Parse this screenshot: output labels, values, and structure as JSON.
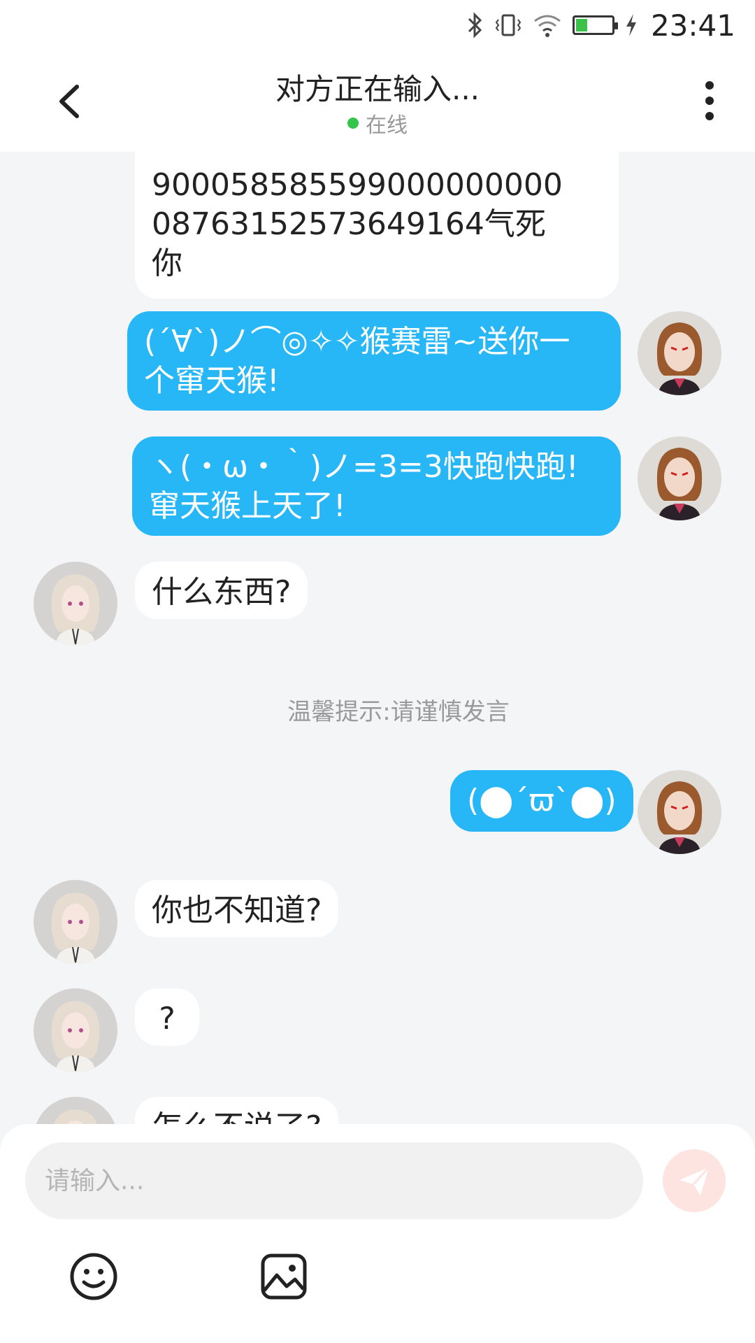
{
  "status_bar": {
    "time": "23:41",
    "icons": [
      "bluetooth-icon",
      "vibrate-icon",
      "wifi-icon",
      "battery-icon",
      "charging-icon"
    ],
    "battery_level": 0.3
  },
  "header": {
    "title": "对方正在输入...",
    "status": "在线",
    "status_color": "#34c64a"
  },
  "messages": [
    {
      "side": "left",
      "text": "90005858559900000000000876315257364916 4气死你"
    },
    {
      "side": "right",
      "text": "(´∀`)ノ⌒◎✧✧猴赛雷~送你一个窜天猴!"
    },
    {
      "side": "right",
      "text": "ヽ(・ω・｀)ノ=3=3快跑快跑!窜天猴上天了!"
    },
    {
      "side": "left",
      "text": "什么东西?"
    },
    {
      "side": "right",
      "text": "(⬤´ϖ`⬤)"
    },
    {
      "side": "left",
      "text": "你也不知道?"
    },
    {
      "side": "left",
      "text": "?"
    },
    {
      "side": "left",
      "text": "怎么不说了?"
    }
  ],
  "m0_line1": "900058585599000000000",
  "m0_line2": "08763152573649164气死",
  "m0_line3": "你",
  "m1_line1": "(´∀`)ノ⌒◎✧✧猴赛雷~送你一",
  "m1_line2": "个窜天猴!",
  "m2_line1": "ヽ(・ω・｀)ノ=3=3快跑快跑!",
  "m2_line2": "窜天猴上天了!",
  "notice": "温馨提示:请谨慎发言",
  "input": {
    "placeholder": "请输入..."
  },
  "colors": {
    "accent": "#27b6f6",
    "background": "#f4f5f7",
    "send_button": "#fde4e1"
  },
  "toolbar": [
    "emoji-icon",
    "image-icon"
  ]
}
